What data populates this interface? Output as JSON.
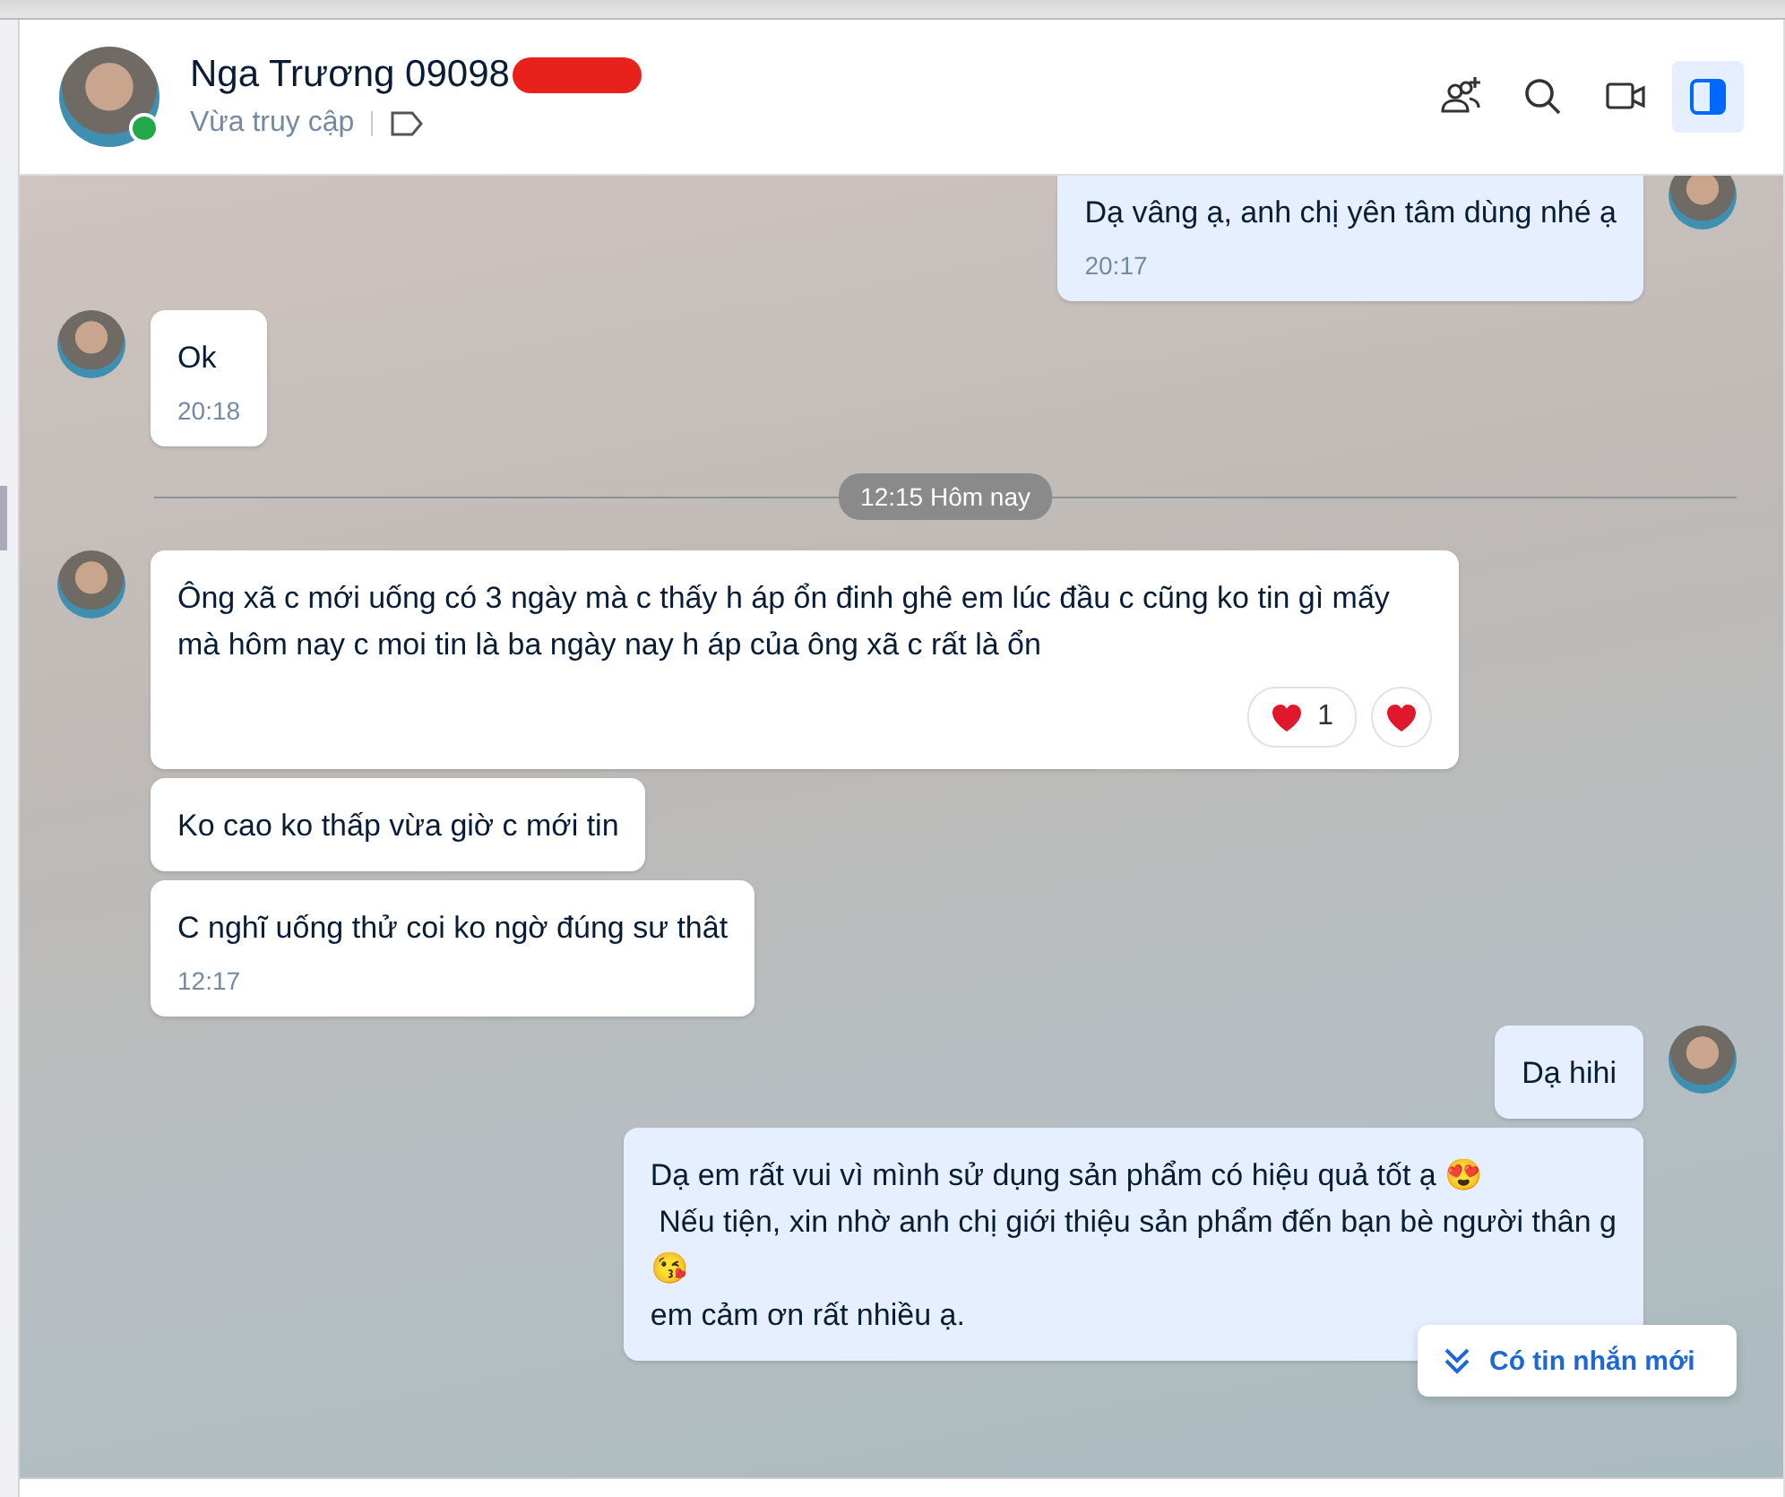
{
  "header": {
    "name": "Nga Trương 09098",
    "online": true,
    "status": "Vừa truy cập",
    "toolbar": [
      {
        "kind": "add-member",
        "selected": false
      },
      {
        "kind": "search",
        "selected": false
      },
      {
        "kind": "video",
        "selected": false
      },
      {
        "kind": "sidebar",
        "selected": true
      }
    ]
  },
  "messages": [
    {
      "kind": "outgoing",
      "avatar": true,
      "lines": [
        {
          "text": "Dạ vâng ạ, anh chị yên tâm dùng nhé ạ"
        }
      ],
      "time": "20:17"
    },
    {
      "kind": "incoming",
      "avatar": true,
      "lines": [
        {
          "text": "Ok"
        }
      ],
      "time": "20:18"
    },
    {
      "kind": "divider",
      "label": "12:15 Hôm nay"
    },
    {
      "kind": "incoming",
      "avatar": true,
      "lines": [
        {
          "text": "Ông xã c mới uống có 3 ngày mà c thấy h áp ổn đinh ghê em lúc đầu c cũng ko tin gì mấy mà hôm nay c moi tin là ba ngày nay h áp của ông xã c rất là ổn"
        }
      ],
      "reactions": [
        {
          "count": "1"
        }
      ],
      "react_button": true
    },
    {
      "kind": "incoming",
      "avatar": false,
      "lines": [
        {
          "text": "Ko cao ko thấp vừa giờ c mới tin"
        }
      ]
    },
    {
      "kind": "incoming",
      "avatar": false,
      "lines": [
        {
          "text": "C nghĩ uống thử coi ko ngờ đúng sư thât"
        }
      ],
      "time": "12:17"
    },
    {
      "kind": "outgoing",
      "avatar": true,
      "lines": [
        {
          "text": "Dạ hihi"
        }
      ]
    },
    {
      "kind": "outgoing",
      "avatar": false,
      "lines": [
        {
          "text": "Dạ em rất vui vì mình sử dụng sản phẩm có hiệu quả tốt ạ 😍"
        },
        {
          "text": " Nếu tiện, xin nhờ anh chị giới thiệu sản phẩm đến bạn bè người thân g"
        },
        {
          "text": "😘"
        },
        {
          "text": "em cảm ơn rất nhiều ạ."
        }
      ]
    }
  ],
  "new_message_button": {
    "label": "Có tin nhắn mới"
  }
}
